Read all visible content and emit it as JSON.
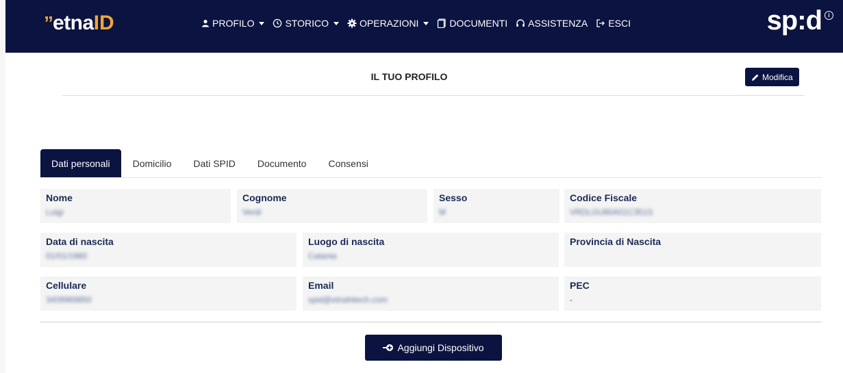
{
  "brand": {
    "mark": "”",
    "name_a": "etna",
    "name_b": "ID",
    "accent": "#f0a43a",
    "navy": "#0b1340"
  },
  "nav": {
    "items": [
      {
        "label": "PROFILO",
        "icon": "user-icon",
        "dropdown": true
      },
      {
        "label": "STORICO",
        "icon": "clock-icon",
        "dropdown": true
      },
      {
        "label": "OPERAZIONI",
        "icon": "gear-icon",
        "dropdown": true
      },
      {
        "label": "DOCUMENTI",
        "icon": "document-icon",
        "dropdown": false
      },
      {
        "label": "ASSISTENZA",
        "icon": "headset-icon",
        "dropdown": false
      },
      {
        "label": "ESCI",
        "icon": "logout-icon",
        "dropdown": false
      }
    ]
  },
  "spid": {
    "logo": "sp:d",
    "info": "i"
  },
  "profile": {
    "title": "IL TUO PROFILO",
    "edit_label": "Modifica"
  },
  "tabs": [
    {
      "label": "Dati personali",
      "active": true
    },
    {
      "label": "Domicilio",
      "active": false
    },
    {
      "label": "Dati SPID",
      "active": false
    },
    {
      "label": "Documento",
      "active": false
    },
    {
      "label": "Consensi",
      "active": false
    }
  ],
  "fields": {
    "nome": {
      "label": "Nome",
      "value": "Luigi"
    },
    "cognome": {
      "label": "Cognome",
      "value": "Verdi"
    },
    "sesso": {
      "label": "Sesso",
      "value": "M"
    },
    "codice_fiscale": {
      "label": "Codice Fiscale",
      "value": "VRDLGU80A01C351S"
    },
    "data_nascita": {
      "label": "Data di nascita",
      "value": "01/01/1980"
    },
    "luogo_nascita": {
      "label": "Luogo di nascita",
      "value": "Catania"
    },
    "provincia_nascita": {
      "label": "Provincia di Nascita",
      "value": ""
    },
    "cellulare": {
      "label": "Cellulare",
      "value": "3409969850"
    },
    "email": {
      "label": "Email",
      "value": "spid@etnahitech.com"
    },
    "pec": {
      "label": "PEC",
      "value": "-"
    }
  },
  "add_device_label": "Aggiungi Dispositivo"
}
